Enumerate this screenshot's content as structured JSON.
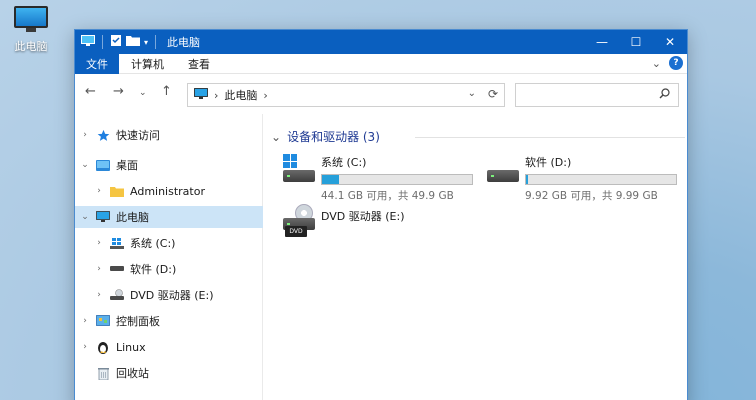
{
  "desktop": {
    "icon_label": "此电脑"
  },
  "window": {
    "title": "此电脑",
    "controls": {
      "minimize": "—",
      "maximize": "☐",
      "close": "✕"
    }
  },
  "ribbon": {
    "tabs": [
      "文件",
      "计算机",
      "查看"
    ],
    "expand": "⌄",
    "help": "?"
  },
  "navbar": {
    "back": "←",
    "forward": "→",
    "recent": "⌄",
    "up": "↑",
    "breadcrumb": "此电脑",
    "crumb_sep": "›",
    "addr_dropdown": "⌄",
    "refresh": "⟳",
    "search_placeholder": "",
    "search_icon": "⌕"
  },
  "sidebar": {
    "items": [
      {
        "label": "快速访问",
        "arrow": "›",
        "icon": "star-icon"
      },
      {
        "label": "桌面",
        "arrow": "⌄",
        "icon": "desktop-folder-icon"
      },
      {
        "label": "Administrator",
        "arrow": "›",
        "icon": "user-folder-icon"
      },
      {
        "label": "此电脑",
        "arrow": "⌄",
        "icon": "computer-icon"
      },
      {
        "label": "系统 (C:)",
        "arrow": "›",
        "icon": "windows-drive-icon"
      },
      {
        "label": "软件 (D:)",
        "arrow": "›",
        "icon": "drive-icon"
      },
      {
        "label": "DVD 驱动器 (E:)",
        "arrow": "›",
        "icon": "dvd-drive-icon"
      },
      {
        "label": "控制面板",
        "arrow": "›",
        "icon": "control-panel-icon"
      },
      {
        "label": "Linux",
        "arrow": "›",
        "icon": "linux-icon"
      },
      {
        "label": "回收站",
        "arrow": "",
        "icon": "recycle-bin-icon"
      }
    ]
  },
  "main": {
    "group_title": "设备和驱动器 (3)",
    "group_arrow": "⌄",
    "drives": [
      {
        "name": "系统 (C:)",
        "free_text": "44.1 GB 可用，共 49.9 GB",
        "used_fraction": 0.116
      },
      {
        "name": "软件 (D:)",
        "free_text": "9.92 GB 可用，共 9.99 GB",
        "used_fraction": 0.007
      },
      {
        "name": "DVD 驱动器 (E:)",
        "badge": "DVD"
      }
    ]
  },
  "colors": {
    "accent": "#0a5fbf",
    "progress": "#26a0da",
    "selection": "#cce4f7",
    "group_title": "#1f3a93"
  }
}
